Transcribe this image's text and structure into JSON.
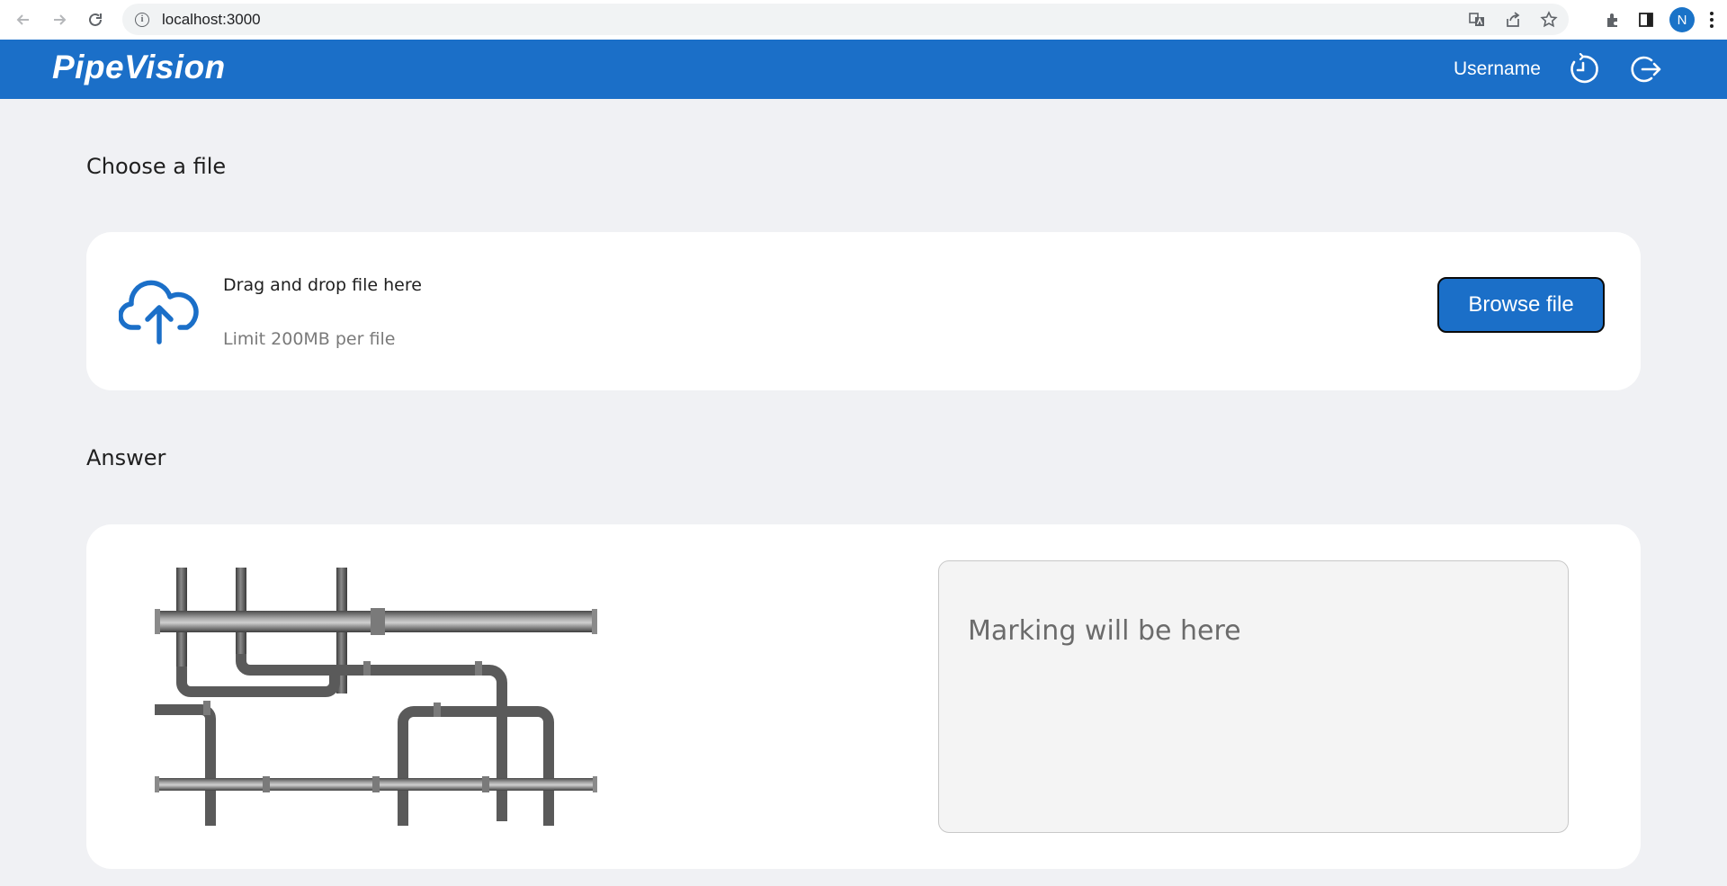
{
  "browser": {
    "url": "localhost:3000",
    "profile_initial": "N",
    "icons": [
      "back-arrow-icon",
      "forward-arrow-icon",
      "reload-icon",
      "site-info-icon",
      "translate-icon",
      "share-icon",
      "bookmark-star-icon",
      "extensions-icon",
      "side-panel-icon",
      "more-menu-icon"
    ]
  },
  "header": {
    "logo": "PipeVision",
    "username": "Username",
    "icons": [
      "history-clock-icon",
      "logout-icon"
    ],
    "accent_color": "#1b6fc8"
  },
  "upload": {
    "section_title": "Choose a file",
    "drag_text": "Drag and drop file here",
    "limit_text": "Limit 200MB per file",
    "browse_button": "Browse file",
    "icon": "cloud-upload-icon"
  },
  "answer": {
    "section_title": "Answer",
    "image": "pipes-illustration",
    "marking_placeholder": "Marking will be here"
  }
}
